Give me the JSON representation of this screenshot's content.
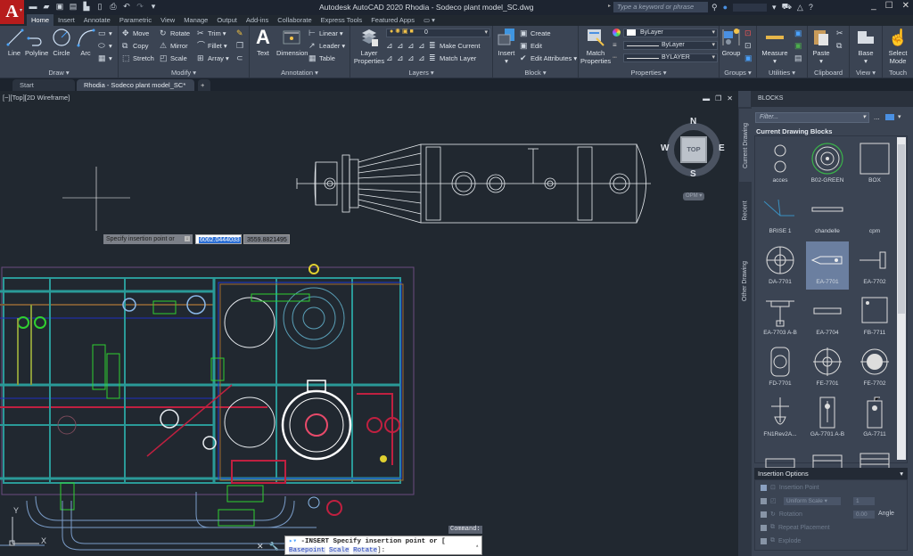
{
  "app": {
    "logo_letter": "A",
    "title": "Autodesk AutoCAD 2020   Rhodia - Sodeco plant model_SC.dwg",
    "search_placeholder": "Type a keyword or phrase",
    "qat_icons": [
      "new-icon",
      "open-icon",
      "save-icon",
      "save-as-icon",
      "import-icon",
      "share-icon",
      "plot-icon",
      "undo-icon",
      "redo-icon",
      "customize-icon"
    ]
  },
  "ribbon_tabs": [
    "Home",
    "Insert",
    "Annotate",
    "Parametric",
    "View",
    "Manage",
    "Output",
    "Add-ins",
    "Collaborate",
    "Express Tools",
    "Featured Apps"
  ],
  "ribbon": {
    "draw": {
      "label": "Draw ▾",
      "line": "Line",
      "polyline": "Polyline",
      "circle": "Circle",
      "arc": "Arc"
    },
    "modify": {
      "label": "Modify ▾",
      "move": "Move",
      "rotate": "Rotate",
      "trim": "Trim ▾",
      "copy": "Copy",
      "mirror": "Mirror",
      "fillet": "Fillet ▾",
      "stretch": "Stretch",
      "scale": "Scale",
      "array": "Array ▾"
    },
    "annotation": {
      "label": "Annotation ▾",
      "text": "Text",
      "dimension": "Dimension",
      "linear": "Linear ▾",
      "leader": "Leader ▾",
      "table": "Table"
    },
    "layers": {
      "label": "Layers ▾",
      "layer_properties_1": "Layer",
      "layer_properties_2": "Properties",
      "layer_value": "0",
      "make_current": "Make Current",
      "match_layer": "Match Layer"
    },
    "block": {
      "label": "Block ▾",
      "insert": "Insert",
      "create": "Create",
      "edit": "Edit",
      "edit_attributes": "Edit Attributes ▾"
    },
    "properties": {
      "label": "Properties ▾",
      "match_1": "Match",
      "match_2": "Properties",
      "color": "ByLayer",
      "linetype": "ByLayer",
      "lineweight": "BYLAYER"
    },
    "groups": {
      "label": "Groups ▾",
      "group": "Group"
    },
    "utilities": {
      "label": "Utilities ▾",
      "measure": "Measure"
    },
    "clipboard": {
      "label": "Clipboard",
      "paste": "Paste"
    },
    "view": {
      "label": "View ▾",
      "base": "Base"
    },
    "touch": {
      "label": "Touch",
      "select_mode_1": "Select",
      "select_mode_2": "Mode"
    }
  },
  "doc_tabs": [
    {
      "label": "Start"
    },
    {
      "label": "Rhodia - Sodeco plant model_SC*"
    }
  ],
  "viewport": {
    "label": "[−][Top][2D Wireframe]",
    "viewcube": {
      "n": "N",
      "s": "S",
      "e": "E",
      "w": "W",
      "face": "TOP",
      "ucs": "OPM"
    },
    "ucs_x": "X",
    "ucs_y": "Y"
  },
  "dynamic_input": {
    "prompt": "Specify insertion point or",
    "x_value": "6062.0444033",
    "y_value": "3559.8821495"
  },
  "command": {
    "label": "Command:",
    "line1": "-INSERT Specify insertion point or [",
    "kw1": "Basepoint",
    "kw2": "Scale",
    "kw3": "Rotate",
    "end": "]:"
  },
  "palette": {
    "header": "BLOCKS",
    "vtabs": [
      "Current Drawing",
      "Recent",
      "Other Drawing"
    ],
    "filter_placeholder": "Filter...",
    "section_title": "Current Drawing Blocks",
    "blocks": [
      "acces",
      "B02-GREEN",
      "BOX",
      "BRISE 1",
      "chandelle",
      "cpm",
      "DA-7701",
      "EA-7701",
      "EA-7702",
      "EA-7703 A-B",
      "EA-7704",
      "FB-7711",
      "FD-7701",
      "FE-7701",
      "FE-7702",
      "FN1Rev2A...",
      "GA-7701 A-B",
      "GA-7711",
      "",
      "",
      ""
    ],
    "selected_block": "EA-7701",
    "insertion_options": {
      "title": "Insertion Options",
      "insertion_point": "Insertion Point",
      "uniform_scale": "Uniform Scale",
      "scale_value": "1",
      "rotation": "Rotation",
      "rotation_value": "0.00",
      "angle": "Angle",
      "repeat": "Repeat Placement",
      "explode": "Explode"
    }
  }
}
